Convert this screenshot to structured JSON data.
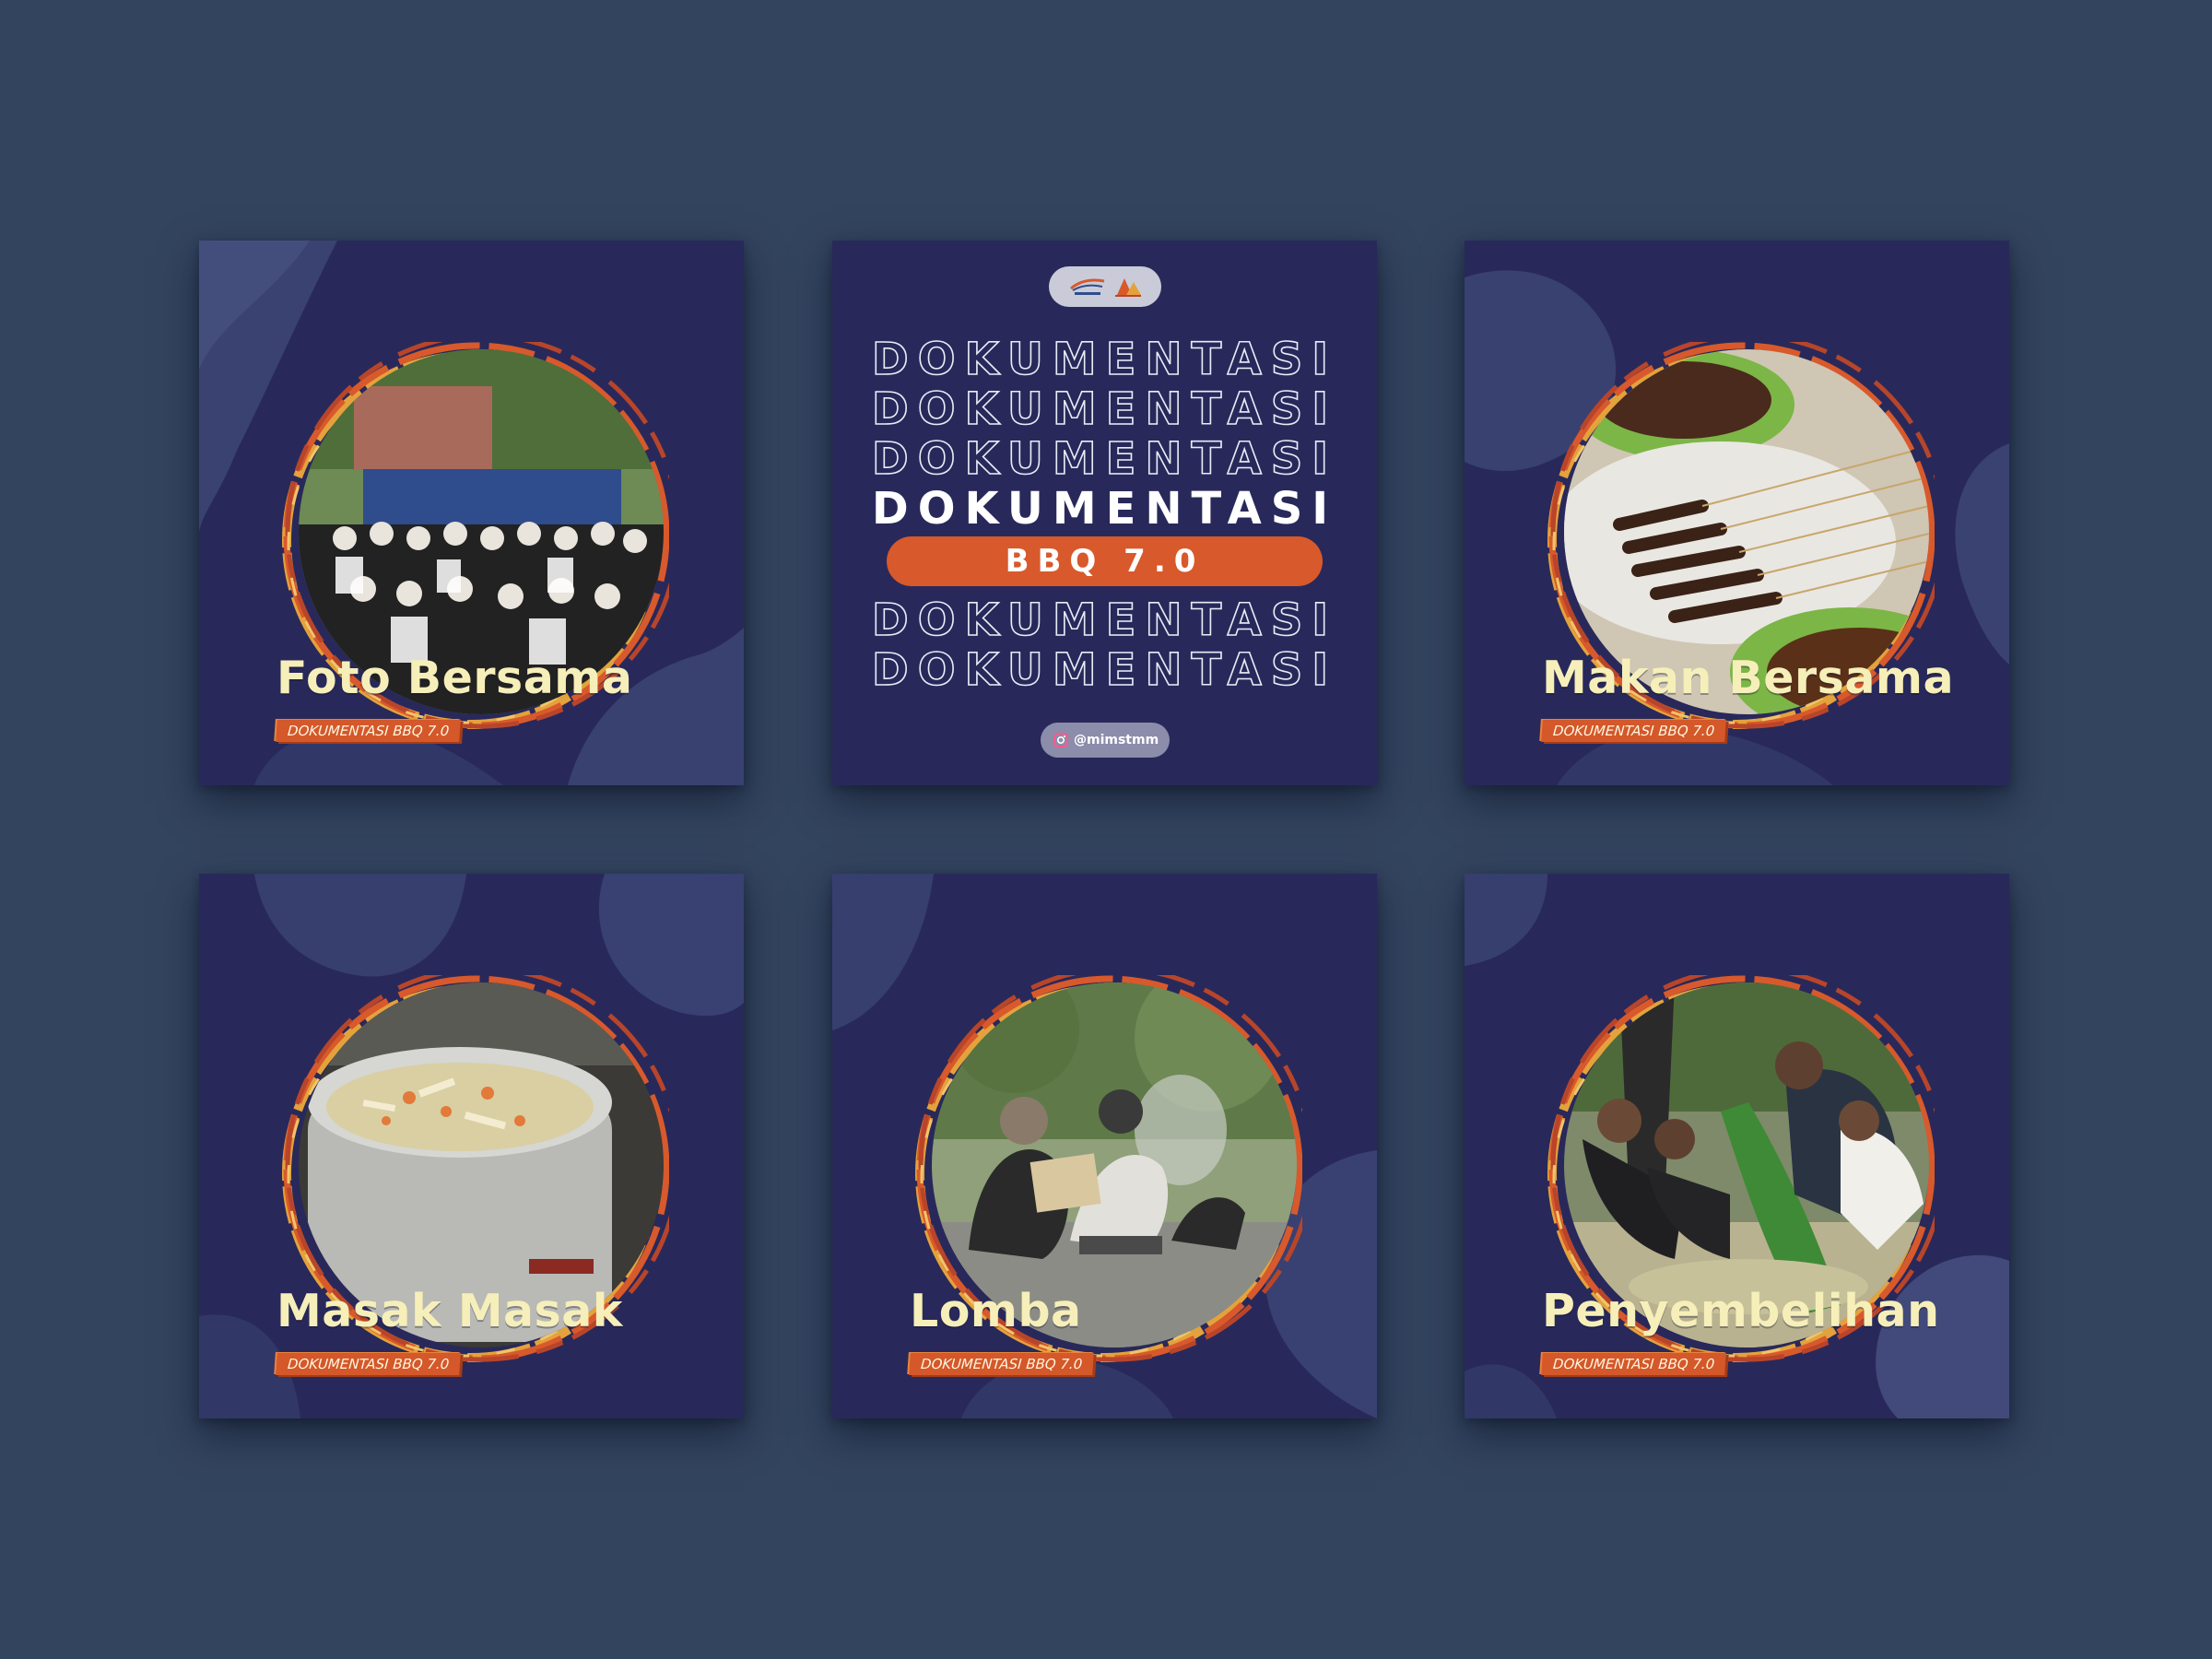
{
  "colors": {
    "page_background": "#33445f",
    "card_background": "#28295a",
    "caption_text": "#f6efb9",
    "accent_orange": "#d8592b",
    "ring_gold": "#e4a23c"
  },
  "cards": [
    {
      "title": "Foto Bersama",
      "tag": "DOKUMENTASI BBQ 7.0",
      "photo": "group-photo"
    },
    {
      "title": "Makan Bersama",
      "tag": "DOKUMENTASI BBQ 7.0",
      "photo": "satay-food-photo"
    },
    {
      "title": "Masak Masak",
      "tag": "DOKUMENTASI BBQ 7.0",
      "photo": "soup-pot-photo"
    },
    {
      "title": "Lomba",
      "tag": "DOKUMENTASI BBQ 7.0",
      "photo": "competition-photo"
    },
    {
      "title": "Penyembelihan",
      "tag": "DOKUMENTASI BBQ 7.0",
      "photo": "banana-leaf-photo"
    }
  ],
  "cover": {
    "repeat_word": "DOKUMENTASI",
    "event": "BBQ 7.0",
    "instagram_handle": "@mimstmm",
    "logos": [
      "organization-logo",
      "event-logo"
    ]
  }
}
